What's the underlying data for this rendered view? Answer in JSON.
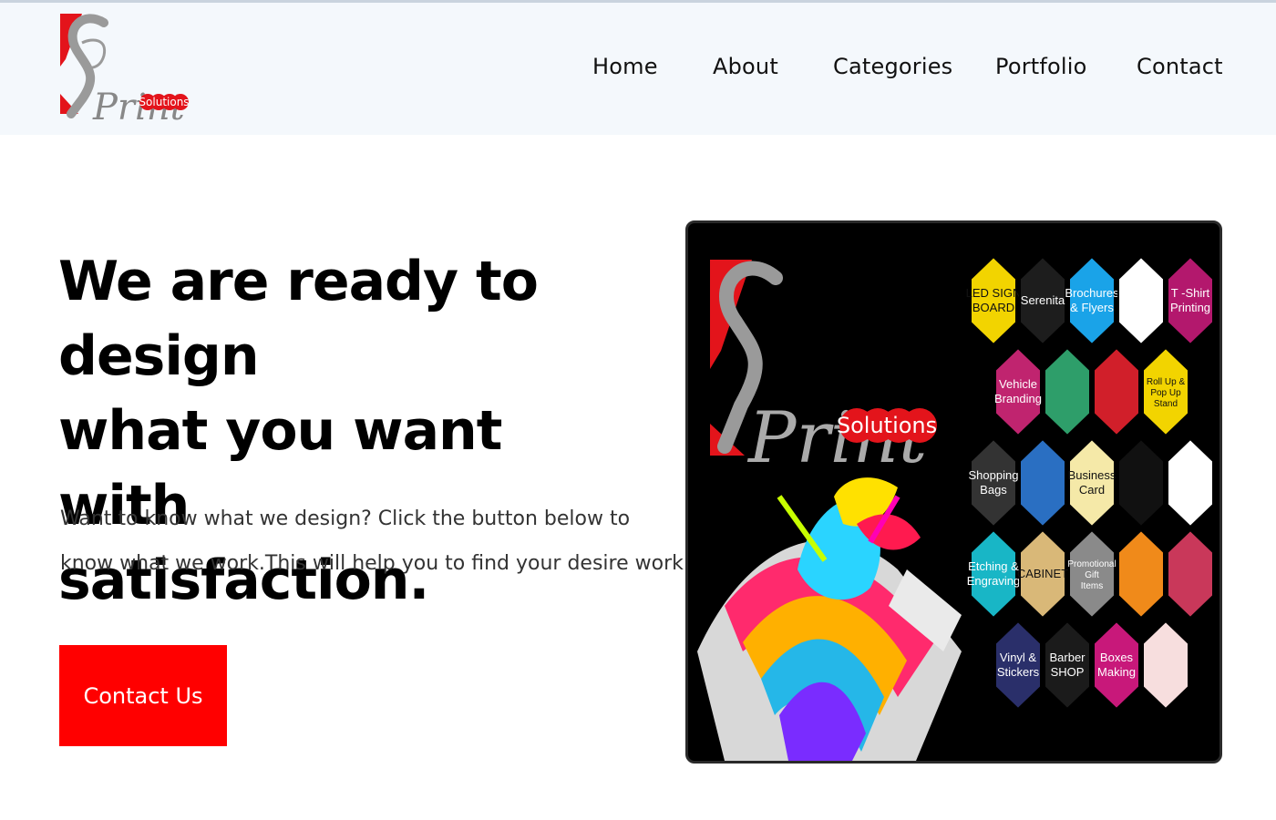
{
  "brand": {
    "logo_text": "Print",
    "logo_sub": "Solutions",
    "colors": {
      "red": "#e3141b",
      "grey": "#9a9a9a",
      "button": "#ff0000",
      "header_bg": "#f4f8fc"
    }
  },
  "nav": {
    "items": [
      {
        "label": "Home"
      },
      {
        "label": "About"
      },
      {
        "label": "Categories"
      },
      {
        "label": "Portfolio"
      },
      {
        "label": "Contact"
      }
    ]
  },
  "hero": {
    "title_lines": [
      "We are ready to design",
      "what you want with",
      "satisfaction."
    ],
    "subtitle_lines": [
      "Want to know what we design? Click the button below to",
      "know what we work.This will help you to find your desire work."
    ],
    "cta_label": "Contact Us"
  },
  "banner": {
    "logo_text": "Print",
    "logo_sub": "Solutions",
    "tiles": [
      {
        "label": "LED SIGN BOARD",
        "color": "#f2d400"
      },
      {
        "label": "Serenita",
        "color": "#1d1d1d"
      },
      {
        "label": "Brochures & Flyers",
        "color": "#1aa3e8"
      },
      {
        "label": "",
        "color": "#ffffff"
      },
      {
        "label": "T -Shirt Printing",
        "color": "#b3186d"
      },
      {
        "label": "Vehicle Branding",
        "color": "#c0246f"
      },
      {
        "label": "",
        "color": "#2e9e6a"
      },
      {
        "label": "",
        "color": "#d11f2a"
      },
      {
        "label": "Roll Up & Pop Up Stand",
        "color": "#f2d400"
      },
      {
        "label": "Shopping Bags",
        "color": "#333333"
      },
      {
        "label": "",
        "color": "#2a6fc2"
      },
      {
        "label": "Business Card",
        "color": "#f5e9a8"
      },
      {
        "label": "",
        "color": "#111111"
      },
      {
        "label": "",
        "color": "#ffffff"
      },
      {
        "label": "Etching & Engraving",
        "color": "#18b6c6"
      },
      {
        "label": "CABINET",
        "color": "#d9b878"
      },
      {
        "label": "Promotional Gift Items",
        "color": "#8a8a8a"
      },
      {
        "label": "",
        "color": "#f08a1a"
      },
      {
        "label": "",
        "color": "#c9385a"
      },
      {
        "label": "Vinyl & Stickers",
        "color": "#2a2f6a"
      },
      {
        "label": "Barber SHOP",
        "color": "#1b1b1b"
      },
      {
        "label": "Boxes Making",
        "color": "#c8187a"
      },
      {
        "label": "",
        "color": "#f7dede"
      }
    ]
  }
}
